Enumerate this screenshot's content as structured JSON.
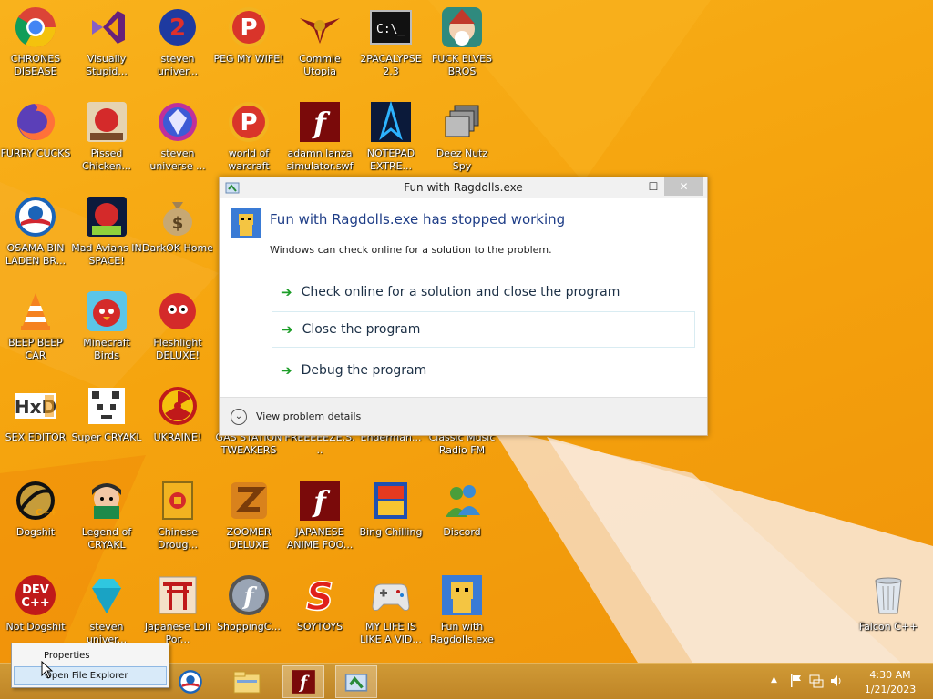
{
  "desktop": {
    "icons": [
      {
        "label": "CHRONES DISEASE",
        "icon": "chrome-icon"
      },
      {
        "label": "Visually Stupid...",
        "icon": "visual-studio-icon"
      },
      {
        "label": "steven univer...",
        "icon": "steven-universe-icon"
      },
      {
        "label": "PEG MY WIFE!",
        "icon": "peggle-icon"
      },
      {
        "label": "Commie Utopia",
        "icon": "commie-utopia-icon"
      },
      {
        "label": "2PACALYPSE 2.3",
        "icon": "terminal-icon"
      },
      {
        "label": "FUCK ELVES BROS",
        "icon": "elf-icon"
      },
      {
        "label": "FURRY CUCKS",
        "icon": "firefox-icon"
      },
      {
        "label": "Pissed Chicken...",
        "icon": "angry-birds-seasons-icon"
      },
      {
        "label": "steven universe ...",
        "icon": "steven-universe-icon"
      },
      {
        "label": "world of warcraft",
        "icon": "peggle-icon"
      },
      {
        "label": "adamn lanza simulator.swf",
        "icon": "flash-icon"
      },
      {
        "label": "NOTEPAD EXTRE...",
        "icon": "notepad-icon"
      },
      {
        "label": "Deez Nutz Spy",
        "icon": "windows-stack-icon"
      },
      {
        "label": "OSAMA BIN LADEN BR...",
        "icon": "obama-logo-icon"
      },
      {
        "label": "Mad Avians IN SPACE!",
        "icon": "angry-birds-space-icon"
      },
      {
        "label": "DarkOK Home",
        "icon": "money-bag-icon"
      },
      {
        "label": "BEEP BEEP CAR",
        "icon": "vlc-icon"
      },
      {
        "label": "Minecraft Birds",
        "icon": "angry-birds-icon"
      },
      {
        "label": "Fleshlight DELUXE!",
        "icon": "red-fluffy-icon"
      },
      {
        "label": "SEX EDITOR",
        "icon": "hxd-icon"
      },
      {
        "label": "Super CRYAKL",
        "icon": "pixel-cat-icon"
      },
      {
        "label": "UKRAINE!",
        "icon": "radiation-icon"
      },
      {
        "label": "GAS STATION TWEAKERS",
        "icon": "generic-icon"
      },
      {
        "label": "FREEEEEZE.S...",
        "icon": "generic-icon"
      },
      {
        "label": "Enderman...",
        "icon": "generic-icon"
      },
      {
        "label": "Classic Music Radio FM",
        "icon": "generic-icon"
      },
      {
        "label": "Dogshit",
        "icon": "dogshit-icon"
      },
      {
        "label": "Legend of CRYAKL",
        "icon": "legend-cryakl-icon"
      },
      {
        "label": "Chinese Droug...",
        "icon": "chinese-icon"
      },
      {
        "label": "ZOOMER DELUXE",
        "icon": "zoomer-icon"
      },
      {
        "label": "JAPANESE ANIME FOO...",
        "icon": "flash-icon"
      },
      {
        "label": "Bing Chilling",
        "icon": "bing-icon"
      },
      {
        "label": "Discord",
        "icon": "messenger-icon"
      },
      {
        "label": "Not Dogshit",
        "icon": "devcpp-icon"
      },
      {
        "label": "steven univer...",
        "icon": "diamond-icon"
      },
      {
        "label": "Japanese Loli Por...",
        "icon": "torii-icon"
      },
      {
        "label": "ShoppingC...",
        "icon": "flash-circle-icon"
      },
      {
        "label": "SOYTOYS",
        "icon": "s-logo-icon"
      },
      {
        "label": "MY LIFE IS LIKE A VID...",
        "icon": "gamepad-icon"
      },
      {
        "label": "Fun with Ragdolls.exe",
        "icon": "ragdoll-icon"
      },
      {
        "label": "Falcon C++",
        "icon": "recycle-bin-icon"
      }
    ]
  },
  "dialog": {
    "title": "Fun with Ragdolls.exe",
    "minimize": "—",
    "maximize": "☐",
    "close": "✕",
    "header": "Fun with Ragdolls.exe has stopped working",
    "subtext": "Windows can check online for a solution to the problem.",
    "commands": [
      "Check online for a solution and close the program",
      "Close the program",
      "Debug the program"
    ],
    "details": "View problem details"
  },
  "context_menu": {
    "items": [
      "Properties",
      "Open File Explorer"
    ]
  },
  "taskbar": {
    "clock_time": "4:30 AM",
    "clock_date": "1/21/2023",
    "tray_up": "▲"
  },
  "colors": {
    "dialog_header": "#1e3d87",
    "arrow_green": "#1c9d28",
    "desktop_orange": "#f5a40e"
  }
}
